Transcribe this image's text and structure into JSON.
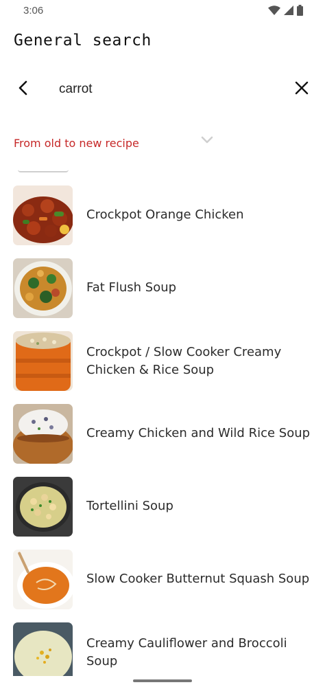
{
  "status_bar": {
    "time": "3:06",
    "icons": [
      "wifi-icon",
      "signal-icon",
      "battery-icon"
    ]
  },
  "page": {
    "title": "General search"
  },
  "search": {
    "back_icon": "arrow-back-icon",
    "query": "carrot",
    "clear_icon": "close-icon"
  },
  "sort": {
    "selected": "From old to new recipe",
    "color": "#c62828",
    "chevron_icon": "chevron-down-icon"
  },
  "recipes": [
    {
      "name": "Crockpot Orange Chicken"
    },
    {
      "name": "Fat Flush Soup"
    },
    {
      "name": "Crockpot / Slow Cooker Creamy Chicken & Rice Soup"
    },
    {
      "name": "Creamy Chicken and Wild Rice Soup"
    },
    {
      "name": "Tortellini Soup"
    },
    {
      "name": "Slow Cooker Butternut Squash Soup"
    },
    {
      "name": "Creamy Cauliflower and Broccoli Soup"
    }
  ]
}
